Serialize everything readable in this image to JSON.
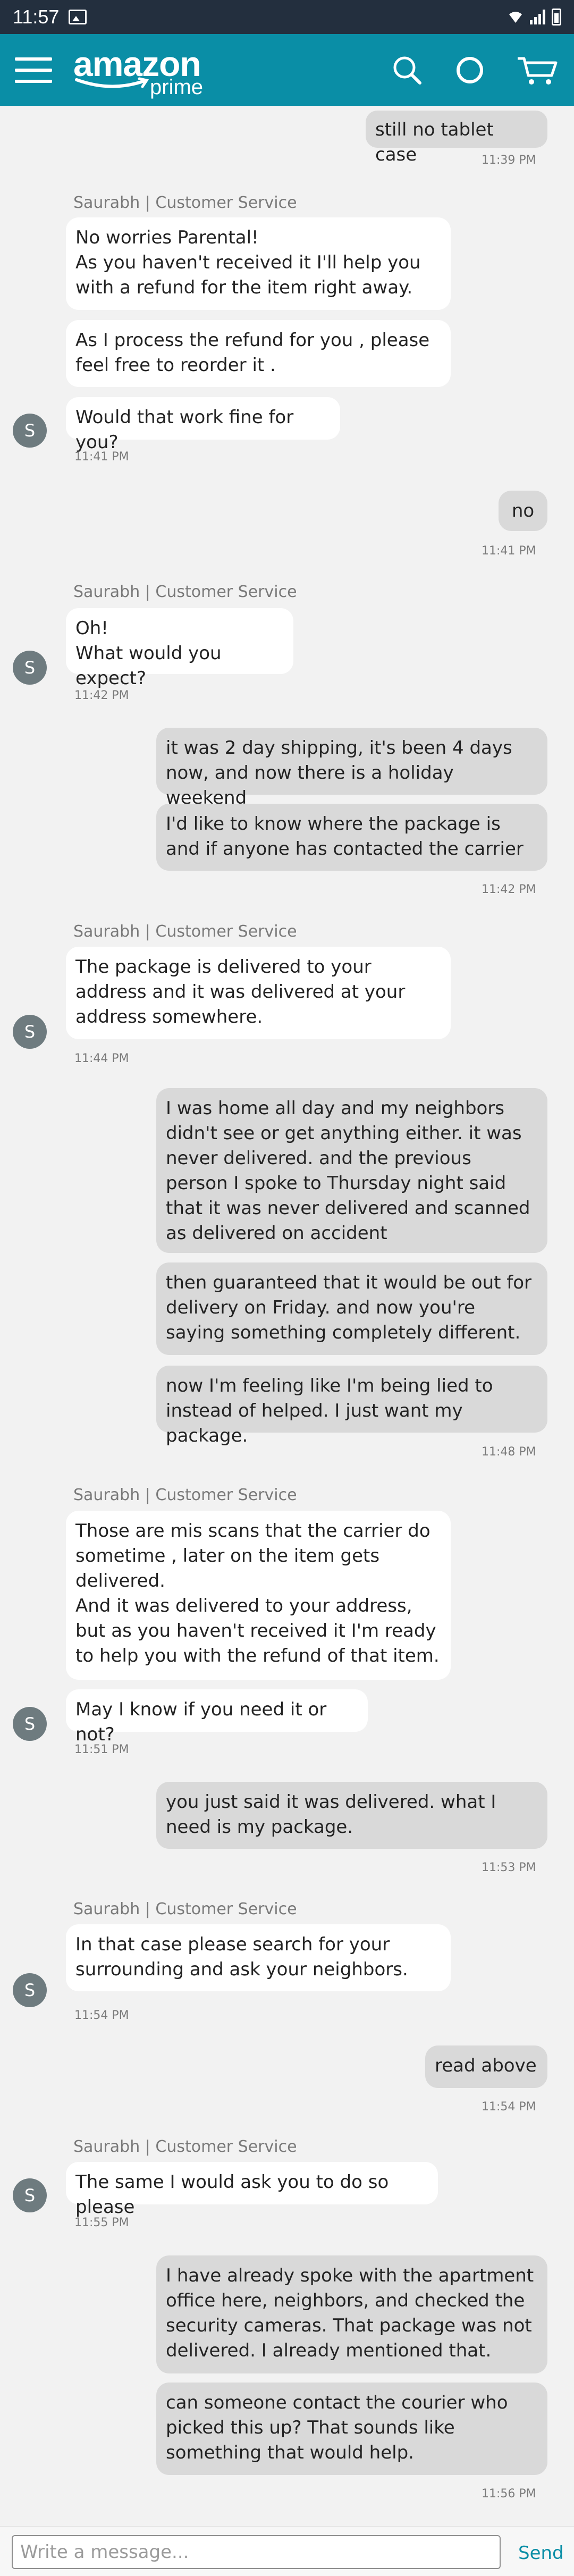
{
  "status_bar": {
    "time": "11:57"
  },
  "header": {
    "logo_word": "amazon",
    "logo_sub": "prime",
    "icons": [
      "menu-icon",
      "search-icon",
      "alexa-icon",
      "cart-icon"
    ]
  },
  "chat": {
    "m1": {
      "text": "still no tablet case",
      "time": "11:39 PM"
    },
    "m2": {
      "sender": "Saurabh | Customer Service",
      "b1": "No worries Parental!\nAs you haven't received it I'll help you with a refund for the item right away.",
      "b2": "As I process the refund for you , please feel free to reorder it .",
      "b3": "Would that work fine for you?",
      "time": "11:41 PM",
      "avatar": "S"
    },
    "m3": {
      "text": "no",
      "time": "11:41 PM"
    },
    "m4": {
      "sender": "Saurabh | Customer Service",
      "b1": "Oh!\nWhat would you expect?",
      "time": "11:42 PM",
      "avatar": "S"
    },
    "m5": {
      "b1": "it was 2 day shipping, it's been 4 days now, and now there is a holiday weekend",
      "b2": "I'd like to know where the package is and if anyone has contacted the carrier",
      "time": "11:42 PM"
    },
    "m6": {
      "sender": "Saurabh | Customer Service",
      "b1": "The package is delivered to your address and it was delivered at your address somewhere.",
      "time": "11:44 PM",
      "avatar": "S"
    },
    "m7": {
      "b1": "I was home all day and my neighbors didn't see or get anything either. it was never delivered. and the previous person I spoke to Thursday night said that it was never delivered and scanned as delivered on accident",
      "b2": "then guaranteed that it would be out for delivery on Friday. and now you're saying something completely different.",
      "b3": "now I'm feeling like I'm being lied to instead of helped. I just want my package.",
      "time": "11:48 PM"
    },
    "m8": {
      "sender": "Saurabh | Customer Service",
      "b1": "Those are mis scans that the carrier do sometime , later on the item gets delivered.\nAnd it was delivered to your address, but as you haven't received it I'm ready to help you with the refund of that item.",
      "b2": "May I know if you need it or not?",
      "time": "11:51 PM",
      "avatar": "S"
    },
    "m9": {
      "text": "you just said it was delivered. what I need is my package.",
      "time": "11:53 PM"
    },
    "m10": {
      "sender": "Saurabh | Customer Service",
      "b1": "In that case please search for your surrounding and ask your neighbors.",
      "time": "11:54 PM",
      "avatar": "S"
    },
    "m11": {
      "text": "read above",
      "time": "11:54 PM"
    },
    "m12": {
      "sender": "Saurabh | Customer Service",
      "b1": "The same I would ask you to do so please",
      "time": "11:55 PM",
      "avatar": "S"
    },
    "m13": {
      "b1": "I have already spoke with the apartment office here, neighbors, and checked the security cameras. That package was not delivered. I already mentioned that.",
      "b2": "can someone contact the courier who picked this up? That sounds like something that would help.",
      "time": "11:56 PM"
    }
  },
  "composer": {
    "placeholder": "Write a message...",
    "send_label": "Send"
  },
  "colors": {
    "status_bar": "#232f3e",
    "header": "#0a8ea6",
    "agent_bubble": "#ffffff",
    "user_bubble": "#d9d9d9",
    "avatar": "#6e7b7f",
    "send": "#0a8ea6"
  }
}
